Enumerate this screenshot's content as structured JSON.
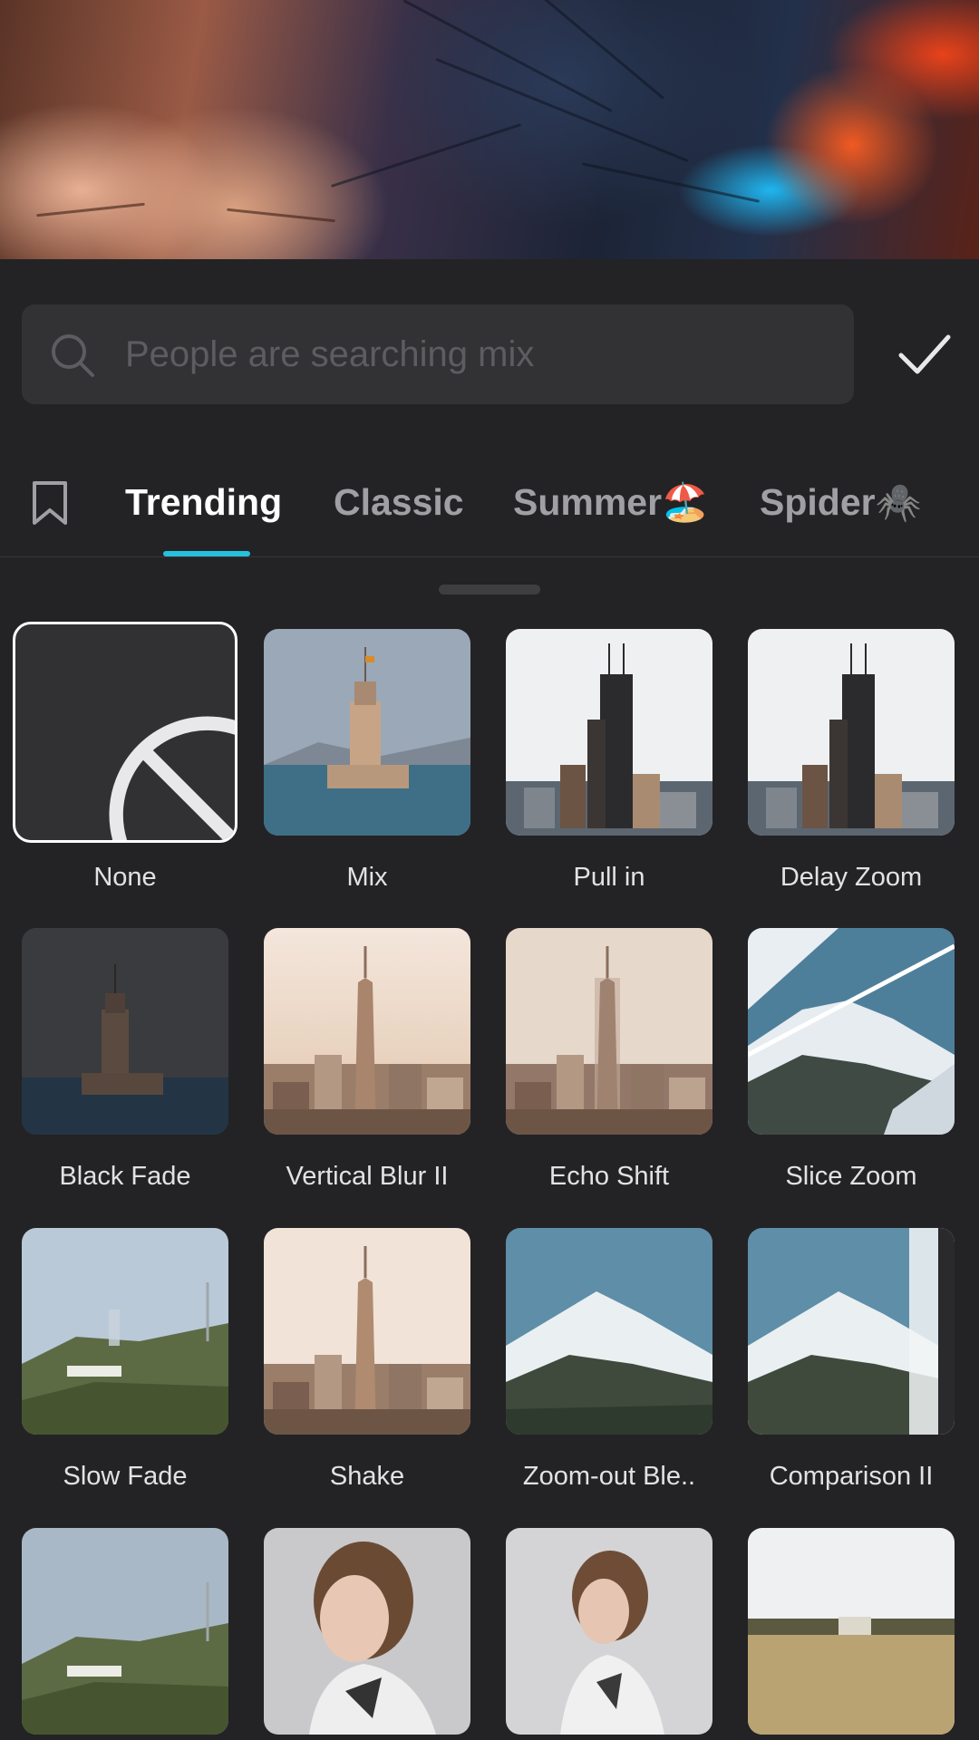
{
  "search": {
    "placeholder": "People are searching mix"
  },
  "tabs": [
    {
      "label": "Trending",
      "active": true
    },
    {
      "label": "Classic",
      "active": false
    },
    {
      "label": "Summer🏖️",
      "active": false
    },
    {
      "label": "Spider🕷️",
      "active": false
    }
  ],
  "transitions": [
    {
      "label": "None",
      "selected": true
    },
    {
      "label": "Mix",
      "selected": false
    },
    {
      "label": "Pull in",
      "selected": false
    },
    {
      "label": "Delay Zoom",
      "selected": false
    },
    {
      "label": "Black Fade",
      "selected": false
    },
    {
      "label": "Vertical Blur II",
      "selected": false
    },
    {
      "label": "Echo Shift",
      "selected": false
    },
    {
      "label": "Slice Zoom",
      "selected": false
    },
    {
      "label": "Slow Fade",
      "selected": false
    },
    {
      "label": "Shake",
      "selected": false
    },
    {
      "label": "Zoom-out Ble..",
      "selected": false
    },
    {
      "label": "Comparison II",
      "selected": false
    },
    {
      "label": "",
      "selected": false
    },
    {
      "label": "",
      "selected": false
    },
    {
      "label": "",
      "selected": false
    },
    {
      "label": "",
      "selected": false
    }
  ],
  "colors": {
    "accent": "#26c2dc",
    "background": "#232325",
    "search_bg": "#323235"
  }
}
